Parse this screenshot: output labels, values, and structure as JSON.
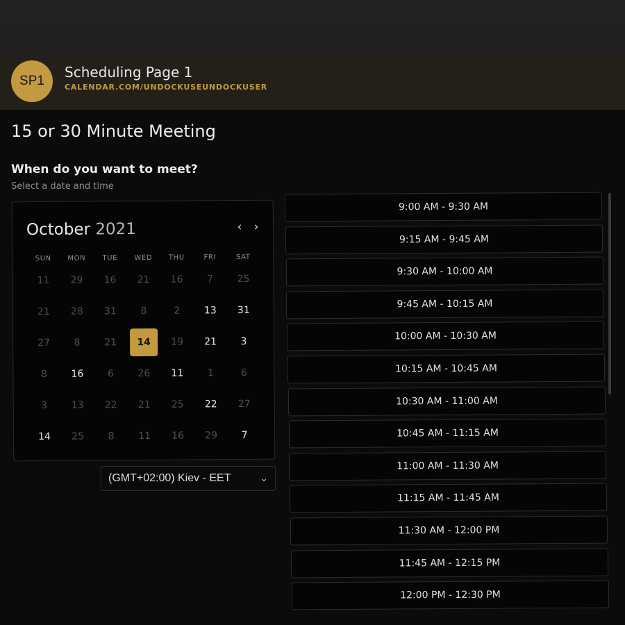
{
  "header": {
    "avatar_initials": "SP1",
    "page_name": "Scheduling Page 1",
    "page_url": "CALENDAR.COM/UNDOCKUSEUNDOCKUSER"
  },
  "meeting": {
    "title": "15 or 30 Minute Meeting",
    "question": "When do you want to meet?",
    "subtext": "Select a date and time"
  },
  "calendar": {
    "month": "October",
    "year": "2021",
    "weekdays": [
      "SUN",
      "MON",
      "TUE",
      "WED",
      "THU",
      "FRI",
      "SAT"
    ],
    "selected_day": "14",
    "weeks": [
      [
        {
          "d": "11",
          "a": false
        },
        {
          "d": "29",
          "a": false
        },
        {
          "d": "16",
          "a": false
        },
        {
          "d": "21",
          "a": false
        },
        {
          "d": "16",
          "a": false
        },
        {
          "d": "7",
          "a": false
        },
        {
          "d": "25",
          "a": false
        }
      ],
      [
        {
          "d": "21",
          "a": false
        },
        {
          "d": "28",
          "a": false
        },
        {
          "d": "31",
          "a": false
        },
        {
          "d": "8",
          "a": false
        },
        {
          "d": "2",
          "a": false
        },
        {
          "d": "13",
          "a": true
        },
        {
          "d": "31",
          "a": true
        }
      ],
      [
        {
          "d": "27",
          "a": false
        },
        {
          "d": "8",
          "a": false
        },
        {
          "d": "21",
          "a": false
        },
        {
          "d": "14",
          "a": true,
          "s": true
        },
        {
          "d": "19",
          "a": false
        },
        {
          "d": "21",
          "a": true
        },
        {
          "d": "3",
          "a": true
        }
      ],
      [
        {
          "d": "8",
          "a": false
        },
        {
          "d": "16",
          "a": true
        },
        {
          "d": "6",
          "a": false
        },
        {
          "d": "26",
          "a": false
        },
        {
          "d": "11",
          "a": true
        },
        {
          "d": "1",
          "a": false
        },
        {
          "d": "6",
          "a": false
        }
      ],
      [
        {
          "d": "3",
          "a": false
        },
        {
          "d": "13",
          "a": false
        },
        {
          "d": "22",
          "a": false
        },
        {
          "d": "21",
          "a": false
        },
        {
          "d": "25",
          "a": false
        },
        {
          "d": "22",
          "a": true
        },
        {
          "d": "27",
          "a": false
        }
      ],
      [
        {
          "d": "14",
          "a": true
        },
        {
          "d": "25",
          "a": false
        },
        {
          "d": "8",
          "a": false
        },
        {
          "d": "11",
          "a": false
        },
        {
          "d": "16",
          "a": false
        },
        {
          "d": "29",
          "a": false
        },
        {
          "d": "7",
          "a": true
        }
      ]
    ],
    "icons": {
      "prev": "chevron-left-icon",
      "next": "chevron-right-icon"
    }
  },
  "timezone": {
    "selected": "(GMT+02:00) Kiev - EET"
  },
  "time_slots": [
    "9:00 AM - 9:30 AM",
    "9:15 AM - 9:45 AM",
    "9:30 AM - 10:00 AM",
    "9:45 AM - 10:15 AM",
    "10:00 AM - 10:30 AM",
    "10:15 AM - 10:45 AM",
    "10:30 AM - 11:00 AM",
    "10:45 AM - 11:15 AM",
    "11:00 AM - 11:30 AM",
    "11:15 AM - 11:45 AM",
    "11:30 AM - 12:00 PM",
    "11:45 AM - 12:15 PM",
    "12:00 PM - 12:30 PM"
  ],
  "colors": {
    "accent": "#c39a3f",
    "background": "#0b0b0b",
    "header": "#23201a"
  }
}
